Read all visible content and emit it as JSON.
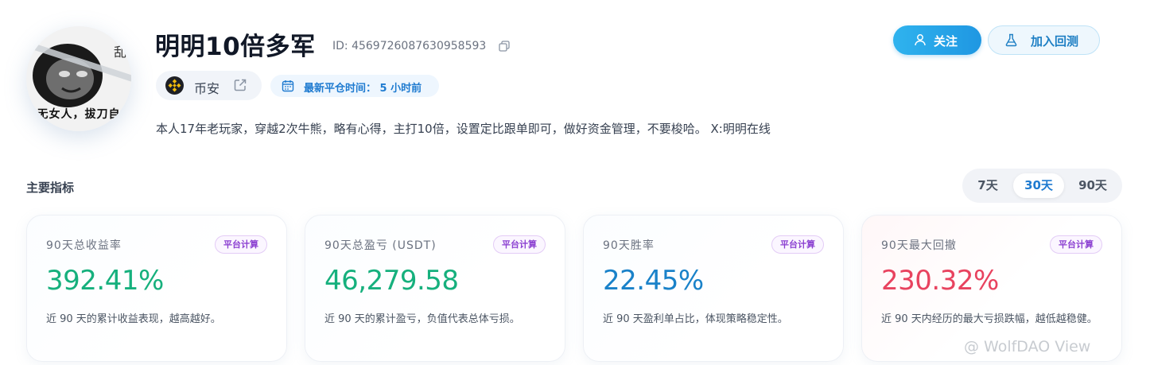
{
  "profile": {
    "avatar_caption": "无女人，拔刀自",
    "name": "明明10倍多军",
    "id_label": "ID: 4569726087630958593",
    "exchange": "币安",
    "last_close": "最新平仓时间： 5 小时前",
    "bio": "本人17年老玩家，穿越2次牛熊，略有心得，主打10倍，设置定比跟单即可，做好资金管理，不要梭哈。 X:明明在线"
  },
  "actions": {
    "follow_label": "关注",
    "backtest_label": "加入回测"
  },
  "metrics": {
    "title": "主要指标",
    "ranges": [
      "7天",
      "30天",
      "90天"
    ],
    "active_range": "30天",
    "cards": [
      {
        "label": "90天总收益率",
        "badge": "平台计算",
        "value": "392.41%",
        "desc": "近 90 天的累计收益表现，越高越好。",
        "color": "#16b07d"
      },
      {
        "label": "90天总盈亏 (USDT)",
        "badge": "平台计算",
        "value": "46,279.58",
        "desc": "近 90 天的累计盈亏，负值代表总体亏损。",
        "color": "#16b07d"
      },
      {
        "label": "90天胜率",
        "badge": "平台计算",
        "value": "22.45%",
        "desc": "近 90 天盈利单占比，体现策略稳定性。",
        "color": "#1a82c9"
      },
      {
        "label": "90天最大回撤",
        "badge": "平台计算",
        "value": "230.32%",
        "desc": "近 90 天内经历的最大亏损跌幅，越低越稳健。",
        "color": "#e8435f"
      }
    ]
  },
  "watermark": "@ WolfDAO View",
  "icons": {
    "copy": "copy-icon",
    "external": "external-link-icon",
    "calendar": "calendar-icon",
    "user": "user-icon",
    "flask": "flask-icon",
    "exchange_logo": "binance-logo"
  }
}
